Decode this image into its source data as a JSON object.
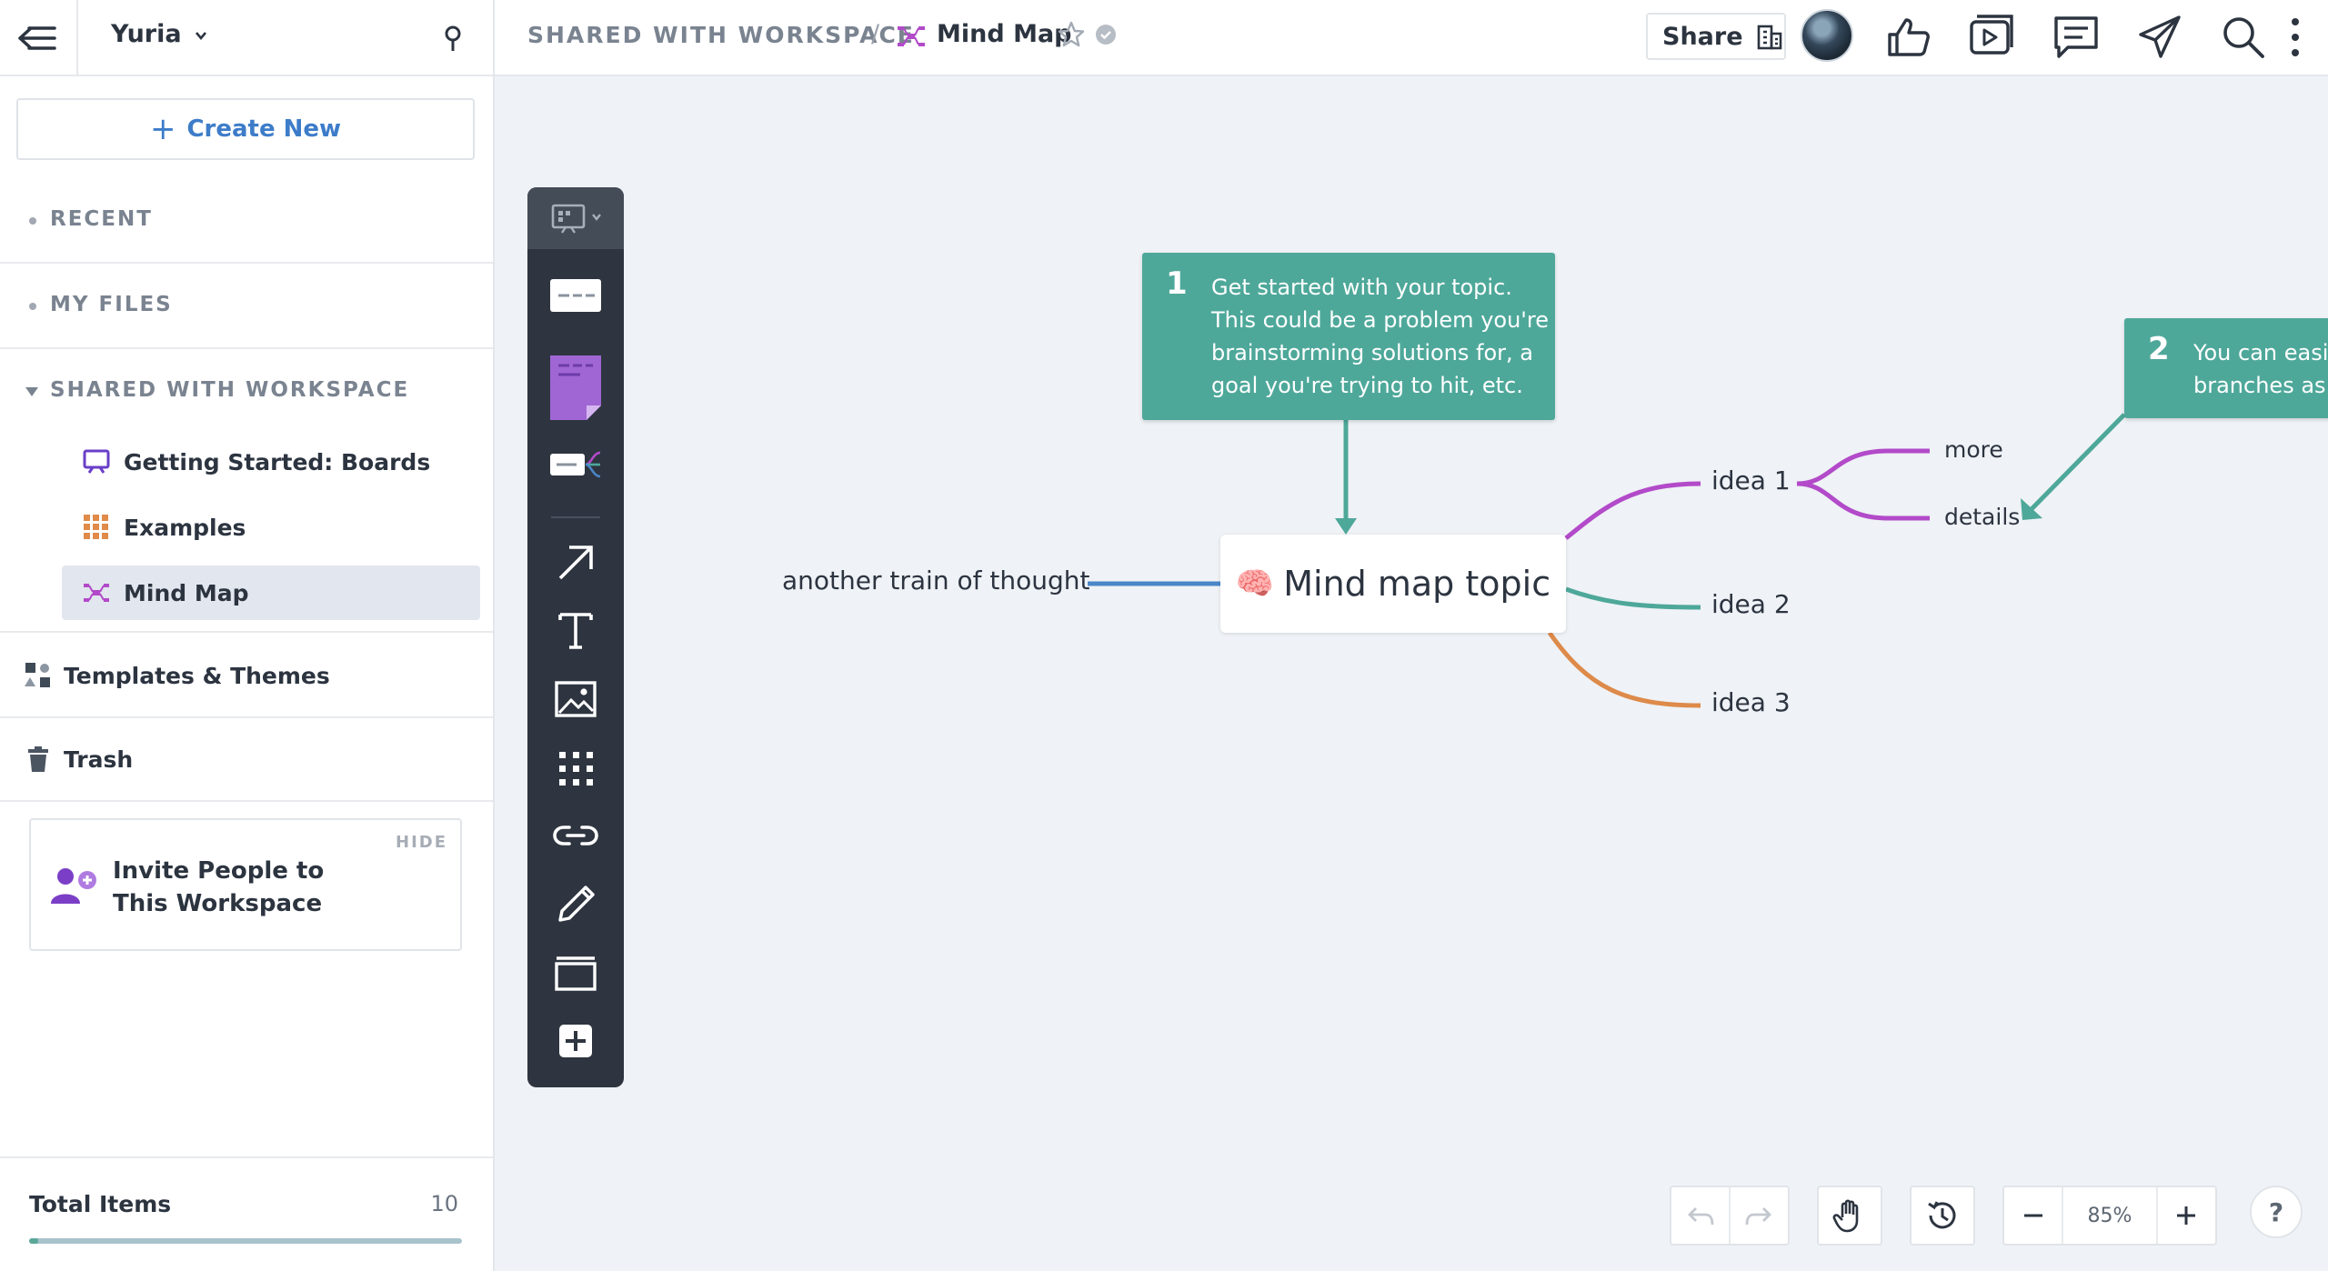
{
  "sidebar": {
    "workspace_name": "Yuria",
    "create_new": "Create New",
    "sections": {
      "recent": "RECENT",
      "my_files": "MY FILES",
      "shared": "SHARED WITH WORKSPACE"
    },
    "shared_items": [
      {
        "label": "Getting Started: Boards",
        "icon": "board-icon"
      },
      {
        "label": "Examples",
        "icon": "grid-icon"
      },
      {
        "label": "Mind Map",
        "icon": "mind-map-icon"
      }
    ],
    "templates": "Templates & Themes",
    "trash": "Trash",
    "invite": {
      "hide": "HIDE",
      "text": "Invite People to This Workspace"
    },
    "total": {
      "label": "Total Items",
      "count": "10"
    }
  },
  "topbar": {
    "breadcrumb_root": "SHARED WITH WORKSPACE",
    "breadcrumb_sep": "/",
    "doc_title": "Mind Map",
    "share_label": "Share"
  },
  "mindmap": {
    "topic": "Mind map topic",
    "left_branch": "another train of thought",
    "ideas": [
      "idea 1",
      "idea 2",
      "idea 3"
    ],
    "sub_ideas": [
      "more",
      "details"
    ],
    "callout1": {
      "num": "1",
      "lines": [
        "Get started with your topic.",
        "This could be a problem you're",
        "brainstorming solutions for, a",
        "goal you're trying to hit, etc."
      ]
    },
    "callout2": {
      "num": "2",
      "lines": [
        "You can easil",
        "branches as"
      ]
    }
  },
  "controls": {
    "zoom": "85%",
    "help": "?"
  },
  "colors": {
    "teal": "#4ea89a",
    "purple": "#b24ac9",
    "blue": "#4a86c8",
    "orange": "#dd8a4a",
    "accent_blue": "#3d7cc9",
    "toolbar_dark": "#2e3540"
  }
}
